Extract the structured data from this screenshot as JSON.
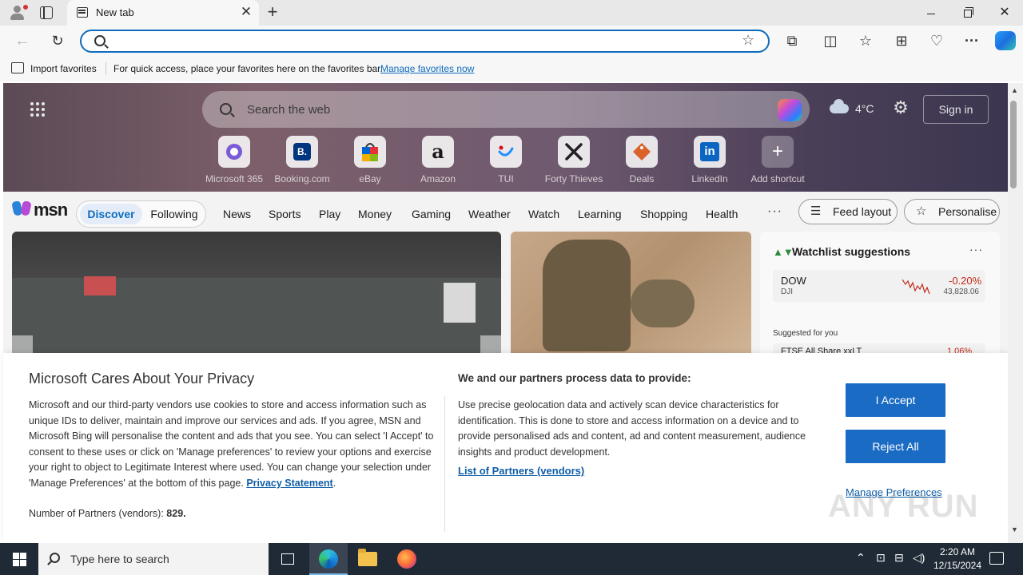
{
  "browser": {
    "tab_title": "New tab",
    "address_value": "",
    "favorites_bar": {
      "import_label": "Import favorites",
      "hint": "For quick access, place your favorites here on the favorites bar.",
      "manage_link": "Manage favorites now"
    }
  },
  "hero": {
    "search_placeholder": "Search the web",
    "weather_temp": "4°C",
    "signin_label": "Sign in",
    "shortcuts": [
      {
        "label": "Microsoft 365",
        "glyph": "",
        "color": "#7b5cd6"
      },
      {
        "label": "Booking.com",
        "glyph": "B.",
        "color": "#003580"
      },
      {
        "label": "eBay",
        "glyph": "",
        "color": "#e53238"
      },
      {
        "label": "Amazon",
        "glyph": "a",
        "color": "#111111"
      },
      {
        "label": "TUI",
        "glyph": "",
        "color": "#1e90ff"
      },
      {
        "label": "Forty Thieves",
        "glyph": "",
        "color": "#222222"
      },
      {
        "label": "Deals",
        "glyph": "",
        "color": "#d9622b"
      },
      {
        "label": "LinkedIn",
        "glyph": "in",
        "color": "#0a66c2"
      },
      {
        "label": "Add shortcut",
        "glyph": "+",
        "color": "#ffffff"
      }
    ]
  },
  "nav": {
    "logo_text": "msn",
    "discover": "Discover",
    "following": "Following",
    "items": [
      "News",
      "Sports",
      "Play",
      "Money",
      "Gaming",
      "Weather",
      "Watch",
      "Learning",
      "Shopping",
      "Health"
    ],
    "more": "···",
    "feed_layout": "Feed layout",
    "personalise": "Personalise"
  },
  "watchlist": {
    "title": "Watchlist suggestions",
    "more": "···",
    "row": {
      "symbol": "DOW",
      "sub": "DJI",
      "change": "-0.20%",
      "value": "43,828.06"
    },
    "suggested_label": "Suggested for you",
    "row2": {
      "symbol": "FTSE All Share xxLT",
      "change": "1.06%"
    }
  },
  "privacy": {
    "title": "Microsoft Cares About Your Privacy",
    "body": "Microsoft and our third-party vendors use cookies to store and access information such as unique IDs to deliver, maintain and improve our services and ads. If you agree, MSN and Microsoft Bing will personalise the content and ads that you see. You can select 'I Accept' to consent to these uses or click on 'Manage preferences' to review your options and exercise your right to object to Legitimate Interest where used.  You can change your selection under 'Manage Preferences' at the bottom of this page.",
    "privacy_link": "Privacy Statement",
    "partners_label": "Number of Partners (vendors):",
    "partners_count": "829.",
    "right_title": "We and our partners process data to provide:",
    "right_body": "Use precise geolocation data and actively scan device characteristics for identification. This is done to store and access information on a device and to provide personalised ads and content, ad and content measurement, audience insights and product development.",
    "list_partners": "List of Partners (vendors)",
    "accept": "I Accept",
    "reject": "Reject All",
    "manage": "Manage Preferences",
    "watermark": "ANY RUN"
  },
  "taskbar": {
    "search_text": "Type here to search",
    "time": "2:20 AM",
    "date": "12/15/2024"
  }
}
